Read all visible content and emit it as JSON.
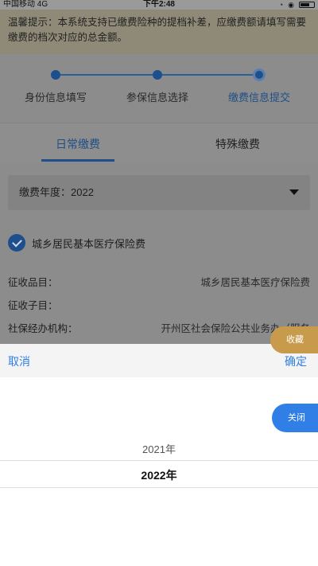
{
  "status_bar": {
    "carrier": "中国移动  4G",
    "time": "下午2:48"
  },
  "notice": {
    "text": "温馨提示：本系统支持已缴费险种的提档补差，应缴费额请填写需要缴费的档次对应的总金额。"
  },
  "steps": [
    {
      "label": "身份信息填写",
      "state": "done"
    },
    {
      "label": "参保信息选择",
      "state": "done"
    },
    {
      "label": "缴费信息提交",
      "state": "current"
    }
  ],
  "tabs": [
    {
      "label": "日常缴费",
      "active": true
    },
    {
      "label": "特殊缴费",
      "active": false
    }
  ],
  "year_select": {
    "label": "缴费年度：2022"
  },
  "insurance_item": {
    "label": "城乡居民基本医疗保险费",
    "checked": true
  },
  "info_rows": [
    {
      "key": "征收品目：",
      "value": "城乡居民基本医疗保险费"
    },
    {
      "key": "征收子目：",
      "value": ""
    },
    {
      "key": "社保经办机构：",
      "value": "开州区社会保险公共业务办（服务"
    }
  ],
  "floating": {
    "favorite": "收藏",
    "close": "关闭"
  },
  "picker": {
    "cancel": "取消",
    "confirm": "确定",
    "options": [
      "2021年",
      "2022年"
    ],
    "selected_index": 1
  },
  "colors": {
    "primary": "#1d4f8c",
    "accent": "#2f7fe6",
    "favorite": "#c89a4c"
  }
}
